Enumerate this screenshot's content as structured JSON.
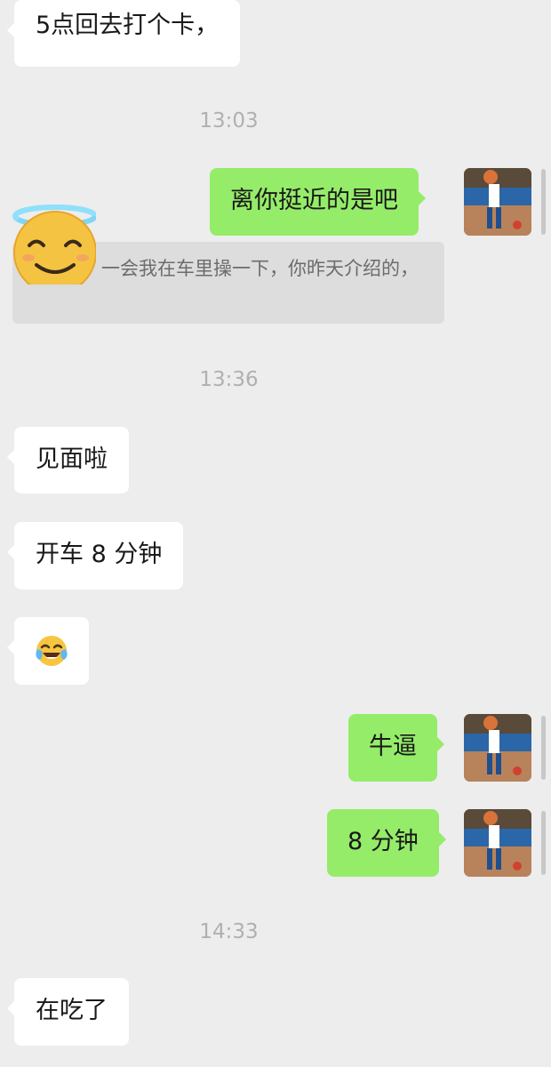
{
  "messages": {
    "m1": "5点回去打个卡，",
    "t1": "13:03",
    "m2": "离你挺近的是吧",
    "quote": "一会我在车里操一下，你昨天介绍的，",
    "t2": "13:36",
    "m3": "见面啦",
    "m4": "开车 8 分钟",
    "m5_emoji": "face-with-tears-of-joy",
    "m6": "牛逼",
    "m7": "8 分钟",
    "t3": "14:33",
    "m8": "在吃了"
  },
  "icons": {
    "overlay_emoji": "smiling-face-with-halo-icon",
    "avatar": "basketball-dunk-avatar"
  },
  "colors": {
    "background": "#ededed",
    "incoming_bubble": "#ffffff",
    "outgoing_bubble": "#95ec69",
    "timestamp": "#b0b0b0",
    "quote_bg": "#dddddd"
  }
}
